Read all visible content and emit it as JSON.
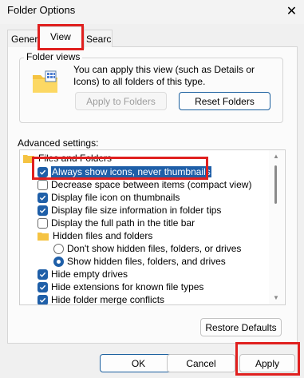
{
  "window": {
    "title": "Folder Options",
    "close_glyph": "✕"
  },
  "tabs": [
    {
      "label": "General"
    },
    {
      "label": "View"
    },
    {
      "label": "Search"
    }
  ],
  "folder_views": {
    "group_label": "Folder views",
    "icon": "folder-grid-icon",
    "description": "You can apply this view (such as Details or Icons) to all folders of this type.",
    "apply_label": "Apply to Folders",
    "reset_label": "Reset Folders"
  },
  "advanced": {
    "label": "Advanced settings:",
    "items": [
      {
        "type": "folder",
        "label": "Files and Folders"
      },
      {
        "type": "checkbox",
        "checked": true,
        "label": "Always show icons, never thumbnails",
        "selected": true
      },
      {
        "type": "checkbox",
        "checked": false,
        "label": "Decrease space between items (compact view)"
      },
      {
        "type": "checkbox",
        "checked": true,
        "label": "Display file icon on thumbnails"
      },
      {
        "type": "checkbox",
        "checked": true,
        "label": "Display file size information in folder tips"
      },
      {
        "type": "checkbox",
        "checked": false,
        "label": "Display the full path in the title bar"
      },
      {
        "type": "folder",
        "label": "Hidden files and folders"
      },
      {
        "type": "radio",
        "on": false,
        "label": "Don't show hidden files, folders, or drives"
      },
      {
        "type": "radio",
        "on": true,
        "label": "Show hidden files, folders, and drives"
      },
      {
        "type": "checkbox",
        "checked": true,
        "label": "Hide empty drives"
      },
      {
        "type": "checkbox",
        "checked": true,
        "label": "Hide extensions for known file types"
      },
      {
        "type": "checkbox",
        "checked": true,
        "label": "Hide folder merge conflicts"
      }
    ],
    "restore_label": "Restore Defaults"
  },
  "footer": {
    "ok_label": "OK",
    "cancel_label": "Cancel",
    "apply_label": "Apply"
  },
  "colors": {
    "accent": "#1f5fa8",
    "highlight_box": "#e0201f"
  }
}
